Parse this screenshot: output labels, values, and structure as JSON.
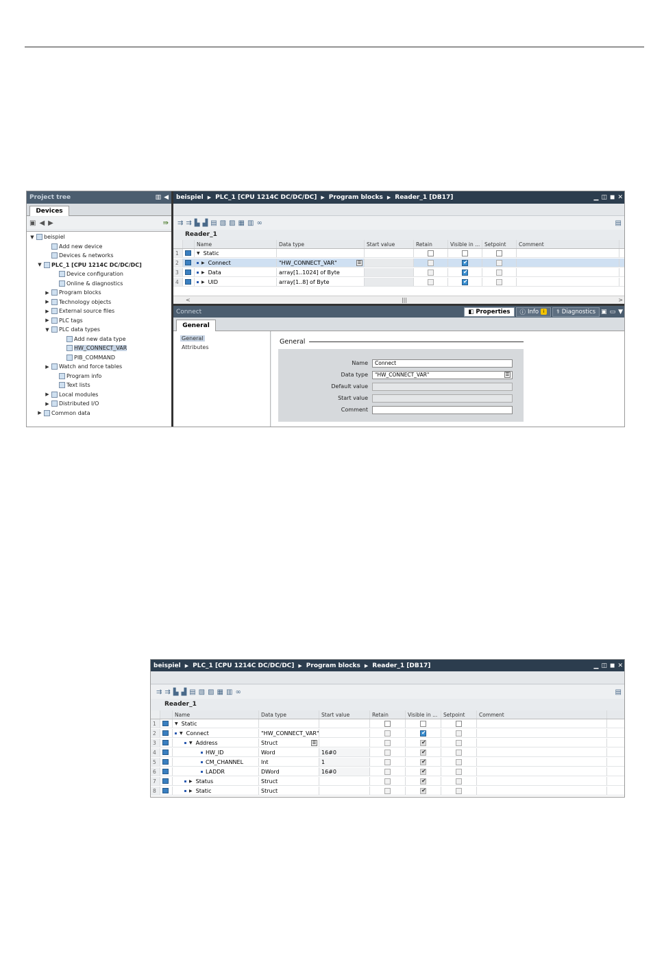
{
  "shot1": {
    "project_tree": {
      "title": "Project tree",
      "tab": "Devices",
      "items": [
        {
          "label": "beispiel",
          "expander": "▼",
          "indent": 0
        },
        {
          "label": "Add new device",
          "expander": "",
          "indent": 2
        },
        {
          "label": "Devices & networks",
          "expander": "",
          "indent": 2
        },
        {
          "label": "PLC_1 [CPU 1214C DC/DC/DC]",
          "expander": "▼",
          "indent": 1,
          "bold": true
        },
        {
          "label": "Device configuration",
          "expander": "",
          "indent": 3
        },
        {
          "label": "Online & diagnostics",
          "expander": "",
          "indent": 3
        },
        {
          "label": "Program blocks",
          "expander": "▶",
          "indent": 2
        },
        {
          "label": "Technology objects",
          "expander": "▶",
          "indent": 2
        },
        {
          "label": "External source files",
          "expander": "▶",
          "indent": 2
        },
        {
          "label": "PLC tags",
          "expander": "▶",
          "indent": 2
        },
        {
          "label": "PLC data types",
          "expander": "▼",
          "indent": 2
        },
        {
          "label": "Add new data type",
          "expander": "",
          "indent": 4
        },
        {
          "label": "HW_CONNECT_VAR",
          "expander": "",
          "indent": 4,
          "selected": true
        },
        {
          "label": "PIB_COMMAND",
          "expander": "",
          "indent": 4
        },
        {
          "label": "Watch and force tables",
          "expander": "▶",
          "indent": 2
        },
        {
          "label": "Program info",
          "expander": "",
          "indent": 3
        },
        {
          "label": "Text lists",
          "expander": "",
          "indent": 3
        },
        {
          "label": "Local modules",
          "expander": "▶",
          "indent": 2
        },
        {
          "label": "Distributed I/O",
          "expander": "▶",
          "indent": 2
        },
        {
          "label": "Common data",
          "expander": "▶",
          "indent": 1
        }
      ]
    },
    "editor": {
      "breadcrumb": [
        "beispiel",
        "PLC_1 [CPU 1214C DC/DC/DC]",
        "Program blocks",
        "Reader_1 [DB17]"
      ],
      "db_name": "Reader_1",
      "columns": [
        "Name",
        "Data type",
        "Start value",
        "Retain",
        "Visible in ...",
        "Setpoint",
        "Comment"
      ],
      "rows": [
        {
          "num": "1",
          "tri": "▼",
          "name": "Static",
          "type": "",
          "start": "",
          "retain": false,
          "visible": false,
          "setpoint": false,
          "dot": false,
          "grey": false,
          "hl": false
        },
        {
          "num": "2",
          "tri": "▶",
          "name": "Connect",
          "type": "\"HW_CONNECT_VAR\"",
          "start": "",
          "retain": false,
          "visible": true,
          "setpoint": false,
          "dot": true,
          "grey": true,
          "hl": true,
          "dd": true
        },
        {
          "num": "3",
          "tri": "▶",
          "name": "Data",
          "type": "array[1..1024] of Byte",
          "start": "",
          "retain": false,
          "visible": true,
          "setpoint": false,
          "dot": true,
          "grey": true,
          "hl": false
        },
        {
          "num": "4",
          "tri": "▶",
          "name": "UID",
          "type": "array[1..8] of Byte",
          "start": "",
          "retain": false,
          "visible": true,
          "setpoint": false,
          "dot": true,
          "grey": true,
          "hl": false
        }
      ]
    },
    "inspector": {
      "title": "Connect",
      "tabs": {
        "properties": "Properties",
        "info": "Info",
        "info_badge": "i",
        "diagnostics": "Diagnostics"
      },
      "subtab": "General",
      "nav": [
        "General",
        "Attributes"
      ],
      "section": "General",
      "fields": [
        {
          "label": "Name",
          "value": "Connect",
          "readonly": false
        },
        {
          "label": "Data type",
          "value": "\"HW_CONNECT_VAR\"",
          "readonly": false,
          "dropdown": true
        },
        {
          "label": "Default value",
          "value": "",
          "readonly": true
        },
        {
          "label": "Start value",
          "value": "",
          "readonly": true
        },
        {
          "label": "Comment",
          "value": "",
          "readonly": false
        }
      ]
    }
  },
  "shot2": {
    "breadcrumb": [
      "beispiel",
      "PLC_1 [CPU 1214C DC/DC/DC]",
      "Program blocks",
      "Reader_1 [DB17]"
    ],
    "db_name": "Reader_1",
    "columns": [
      "Name",
      "Data type",
      "Start value",
      "Retain",
      "Visible in ...",
      "Setpoint",
      "Comment"
    ],
    "rows": [
      {
        "num": "1",
        "tri": "▼",
        "name": "Static",
        "type": "",
        "start": "",
        "level": 0,
        "dot": false,
        "visible": false
      },
      {
        "num": "2",
        "tri": "▼",
        "name": "Connect",
        "type": "\"HW_CONNECT_VAR\"",
        "start": "",
        "level": 0,
        "dot": true,
        "visible": true,
        "blue": true
      },
      {
        "num": "3",
        "tri": "▼",
        "name": "Address",
        "type": "Struct",
        "start": "",
        "level": 1,
        "dot": true,
        "visible": true,
        "dd": true
      },
      {
        "num": "4",
        "tri": "",
        "name": "HW_ID",
        "type": "Word",
        "start": "16#0",
        "level": 2,
        "dot": true,
        "visible": true
      },
      {
        "num": "5",
        "tri": "",
        "name": "CM_CHANNEL",
        "type": "Int",
        "start": "1",
        "level": 2,
        "dot": true,
        "visible": true
      },
      {
        "num": "6",
        "tri": "",
        "name": "LADDR",
        "type": "DWord",
        "start": "16#0",
        "level": 2,
        "dot": true,
        "visible": true
      },
      {
        "num": "7",
        "tri": "▶",
        "name": "Status",
        "type": "Struct",
        "start": "",
        "level": 1,
        "dot": true,
        "visible": true
      },
      {
        "num": "8",
        "tri": "▶",
        "name": "Static",
        "type": "Struct",
        "start": "",
        "level": 1,
        "dot": true,
        "visible": true
      }
    ]
  }
}
